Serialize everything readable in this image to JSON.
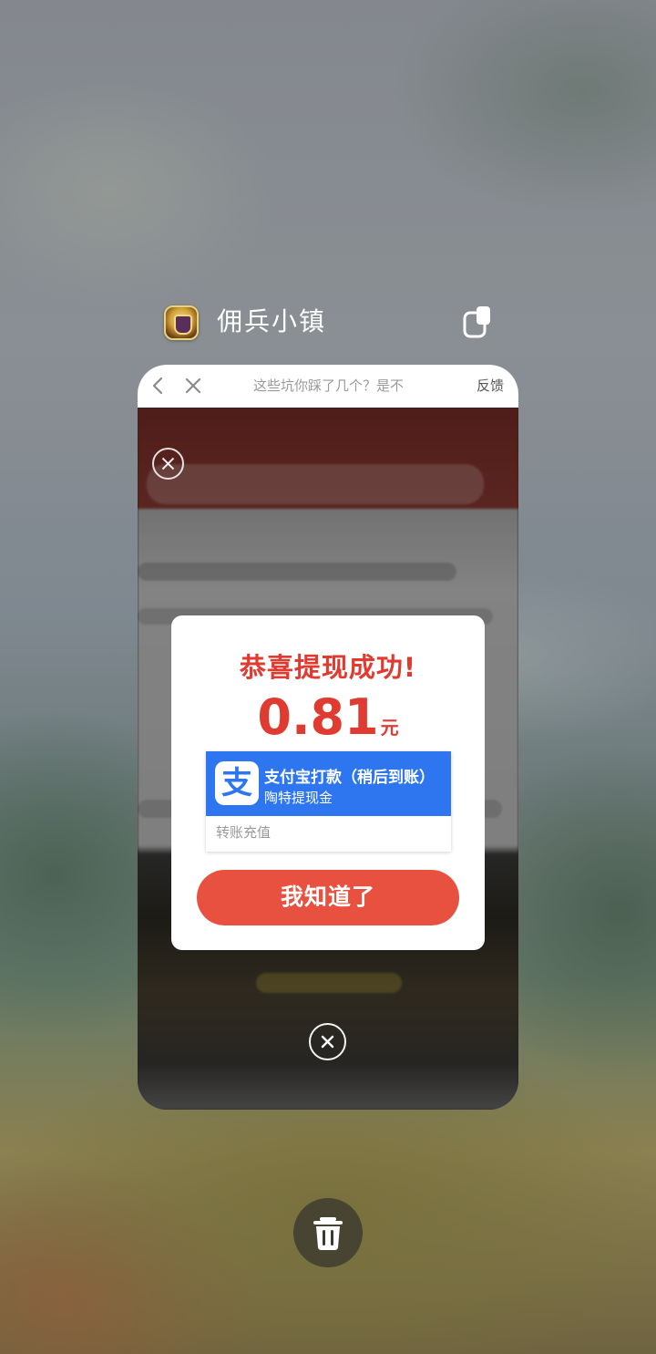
{
  "app": {
    "name": "佣兵小镇",
    "icon": "mercenary-town-app-icon"
  },
  "browser": {
    "title": "这些坑你踩了几个？是不",
    "feedback_label": "反馈"
  },
  "popup": {
    "title": "恭喜提现成功!",
    "amount": "0.81",
    "unit": "元",
    "payment": {
      "title": "支付宝打款（稍后到账）",
      "subtitle": "陶特提现金",
      "footer": "转账充值",
      "icon_glyph": "支",
      "color": "#2e76f0"
    },
    "confirm_label": "我知道了",
    "accent_color": "#e03b30"
  },
  "recents": {
    "clear_icon": "trash-icon"
  }
}
